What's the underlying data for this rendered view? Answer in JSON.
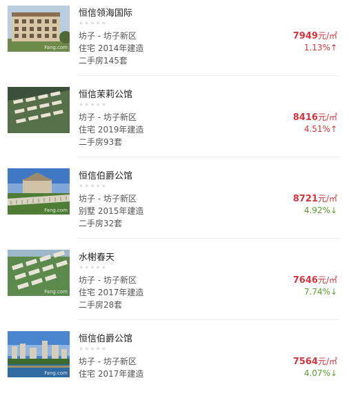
{
  "listings": [
    {
      "name": "恒信领海国际",
      "district": "坊子 - 坊子新区",
      "type_year": "住宅 2014年建造",
      "second_hand": "二手房145套",
      "price": "7949",
      "price_unit": "元/㎡",
      "change": "1.13%",
      "change_arrow": "↑",
      "trend": "up",
      "rating_stars": "★★★★★",
      "watermark": "Fang.com"
    },
    {
      "name": "恒信茉莉公馆",
      "district": "坊子 - 坊子新区",
      "type_year": "住宅 2019年建造",
      "second_hand": "二手房93套",
      "price": "8416",
      "price_unit": "元/㎡",
      "change": "4.51%",
      "change_arrow": "↑",
      "trend": "up",
      "rating_stars": "★★★★★",
      "watermark": ""
    },
    {
      "name": "恒信伯爵公馆",
      "district": "坊子 - 坊子新区",
      "type_year": "别墅 2015年建造",
      "second_hand": "二手房32套",
      "price": "8721",
      "price_unit": "元/㎡",
      "change": "4.92%",
      "change_arrow": "↓",
      "trend": "down",
      "rating_stars": "★★★★★",
      "watermark": "Fang.com"
    },
    {
      "name": "水榭春天",
      "district": "坊子 - 坊子新区",
      "type_year": "住宅 2017年建造",
      "second_hand": "二手房28套",
      "price": "7646",
      "price_unit": "元/㎡",
      "change": "7.74%",
      "change_arrow": "↓",
      "trend": "down",
      "rating_stars": "★★★★★",
      "watermark": "Fang.com"
    },
    {
      "name": "恒信伯爵公馆",
      "district": "坊子 - 坊子新区",
      "type_year": "住宅 2017年建造",
      "second_hand": "",
      "price": "7564",
      "price_unit": "元/㎡",
      "change": "4.07%",
      "change_arrow": "↓",
      "trend": "down",
      "rating_stars": "★★★★★",
      "watermark": "Fang.com"
    }
  ],
  "colors": {
    "price_red": "#d4353d",
    "rise_red": "#d4353d",
    "fall_green": "#5aa02c"
  }
}
